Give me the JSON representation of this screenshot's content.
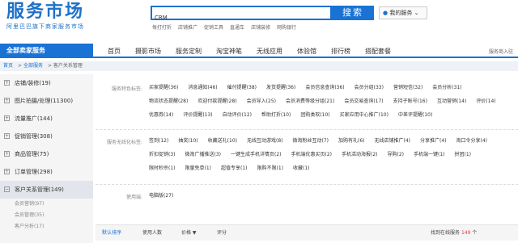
{
  "logo": {
    "main": "服务市场",
    "sub": "阿里巴巴旗下商家服务市场"
  },
  "search": {
    "value": "CRM",
    "button": "搜索"
  },
  "my_service": "我的服务 ⌄",
  "hot_words": [
    "每打打折",
    "店铺推广",
    "促销工具",
    "直通车",
    "店铺装修",
    "网购银行"
  ],
  "nav": {
    "all": "全部卖家服务",
    "items": [
      "首页",
      "摄影市场",
      "服务定制",
      "淘宝神笔",
      "无线应用",
      "体验馆",
      "排行榜",
      "搭配套餐"
    ],
    "right": "服务商入驻"
  },
  "breadcrumb": [
    "首页",
    "全部服务",
    "客户关系管理"
  ],
  "sidebar": [
    {
      "label": "店铺/装修(19)"
    },
    {
      "label": "图片拍摄/处理(11300)"
    },
    {
      "label": "流量推广(144)"
    },
    {
      "label": "促销管理(308)"
    },
    {
      "label": "商品管理(75)"
    },
    {
      "label": "订单管理(298)"
    },
    {
      "label": "客户关系管理(149)"
    }
  ],
  "sidebar_sub": [
    "会员营销(97)",
    "会员管理(35)",
    "客户分析(17)"
  ],
  "filters": {
    "feature_label": "服务特色标签:",
    "feature_tags": [
      "买家提醒(36)",
      "消息通知(46)",
      "催付提醒(38)",
      "发货提醒(36)",
      "会员信息查询(36)",
      "会员分组(33)",
      "营销短信(32)",
      "会员分析(31)",
      "物流状态提醒(28)",
      "欢迎付款提醒(28)",
      "会员导入(25)",
      "会员消费等级分组(21)",
      "会员交易查询(17)",
      "支持子账号(16)",
      "互动营销(14)",
      "评价(14)",
      "优惠券(14)",
      "评价提醒(13)",
      "自动评价(12)",
      "帮助打折(10)",
      "团购类软(10)",
      "买家应用中心推广(10)",
      "中差评提醒(10)"
    ],
    "wireless_label": "服务无线化标签:",
    "wireless_tags": [
      "签到(12)",
      "抽奖(10)",
      "收藏送礼(10)",
      "无线互动游戏(8)",
      "微淘粉丝互动(7)",
      "加购有礼(6)",
      "无线店铺推广(4)",
      "分享推广(4)",
      "淘口令分享(4)",
      "折扣促销(3)",
      "微淘广播推送(3)",
      "一键生成手机详情页(2)",
      "手机端优惠买页(2)",
      "手机活动海报(2)",
      "导购(2)",
      "手机端一键(1)",
      "拼团(1)",
      "限时秒杀(1)",
      "限量免单(1)",
      "超值专享(1)",
      "限购不限(1)",
      "收藏(1)"
    ],
    "usage_label": "使用端:",
    "usage_tags": [
      "电脑版(27)"
    ]
  },
  "sortbar": {
    "default": "默认排序",
    "users": "使用人数",
    "price": "价格 ▼",
    "rating": "评分",
    "count_prefix": "找到在线服务",
    "count_num": "149",
    "count_suffix": "个"
  }
}
